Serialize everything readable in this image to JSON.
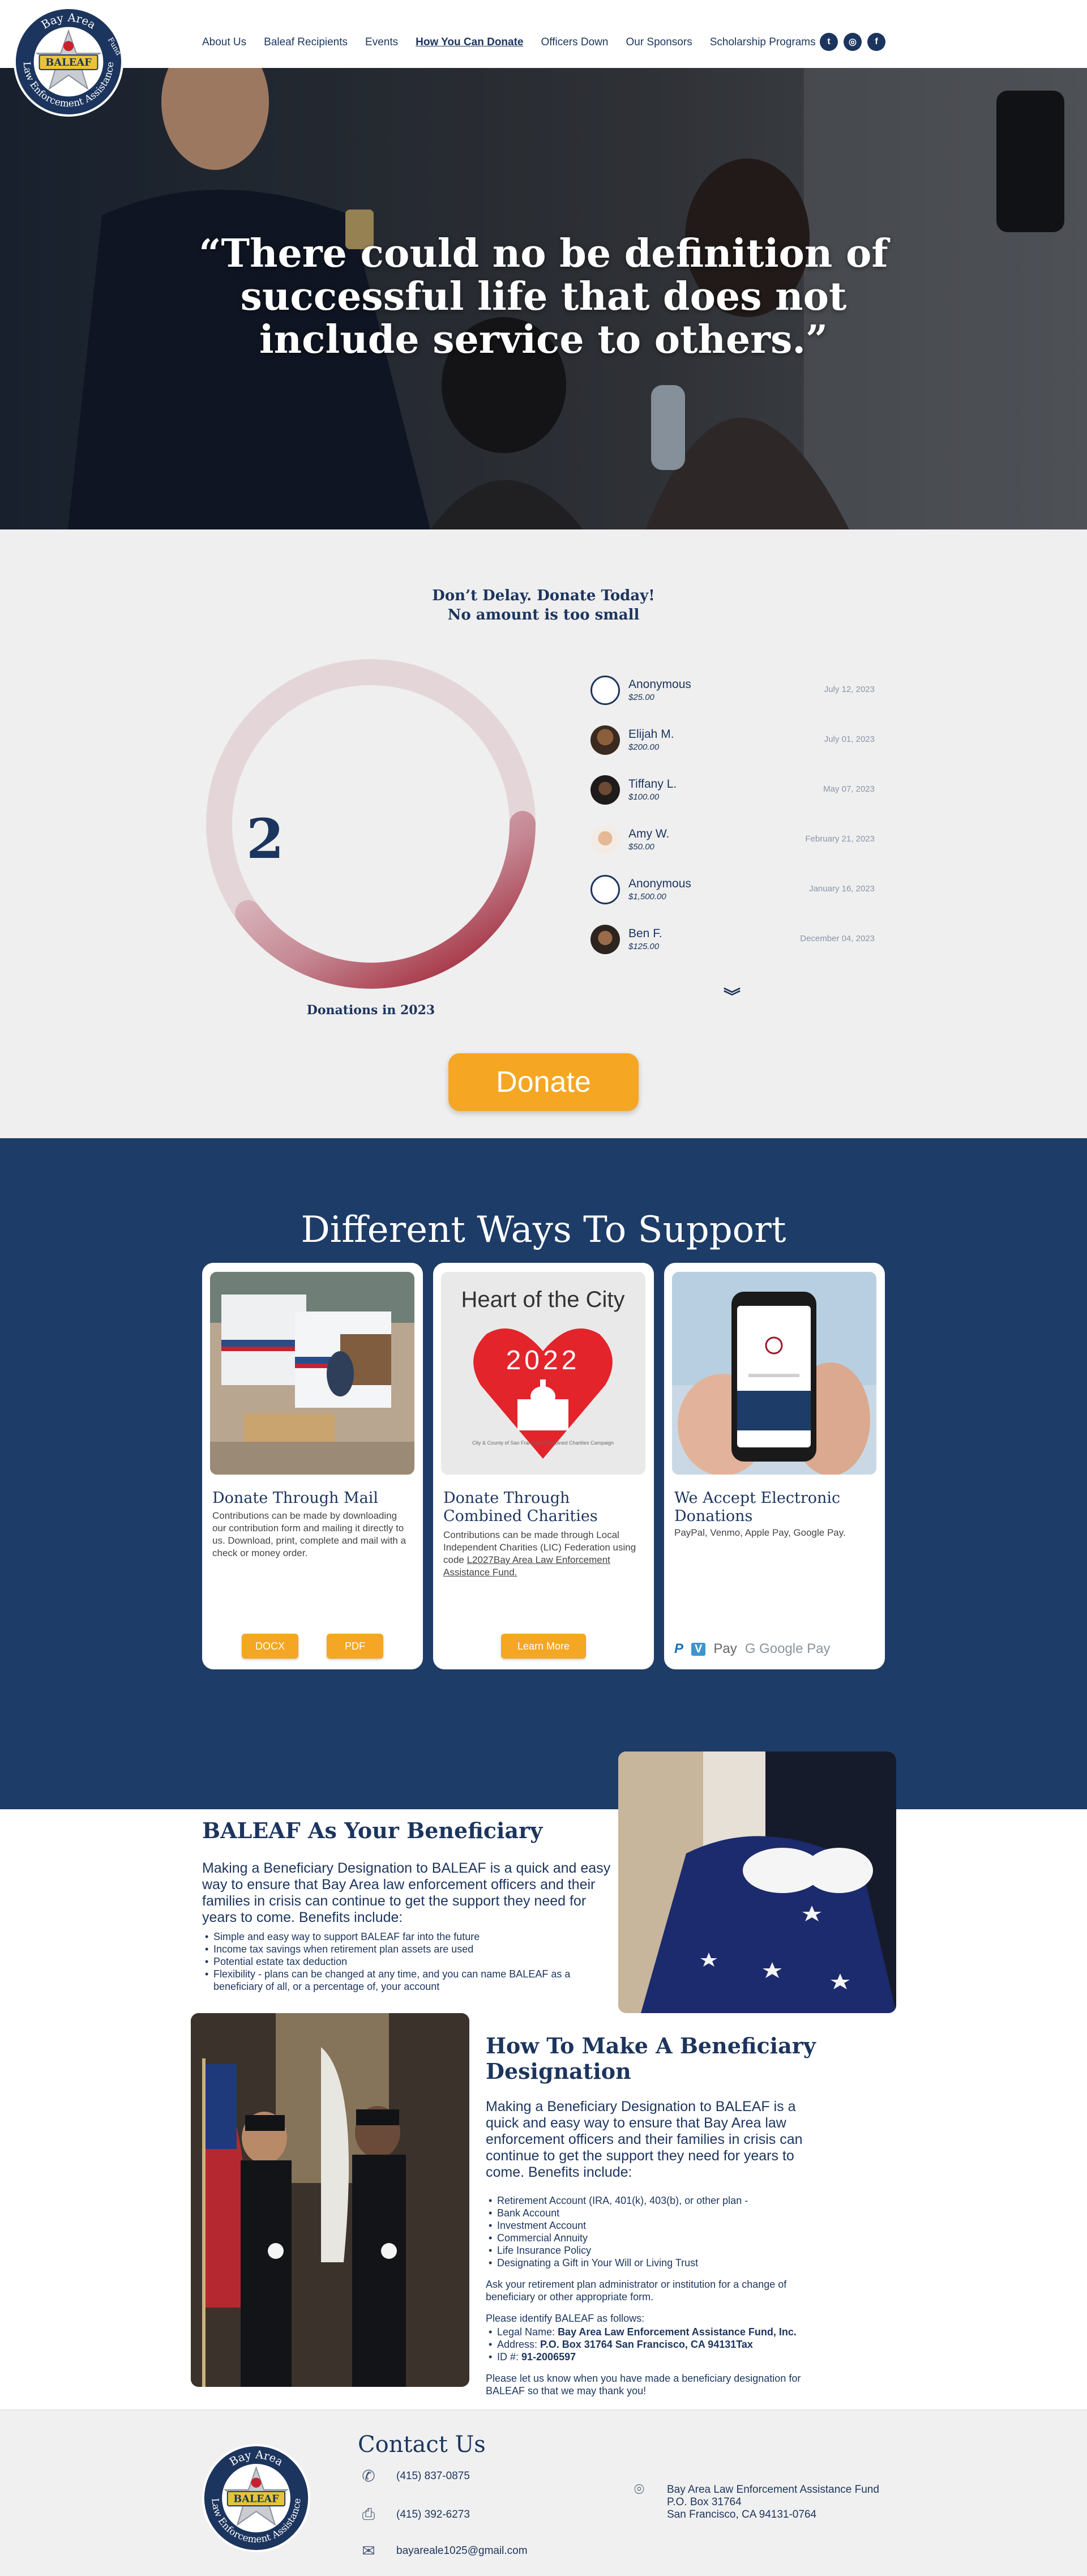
{
  "nav": {
    "links": [
      "About Us",
      "Baleaf Recipients",
      "Events",
      "How You Can Donate",
      "Officers Down",
      "Our Sponsors",
      "Scholarship Programs"
    ],
    "active_index": 3,
    "social": [
      {
        "icon": "twitter-icon",
        "glyph": "t"
      },
      {
        "icon": "instagram-icon",
        "glyph": "◎"
      },
      {
        "icon": "facebook-icon",
        "glyph": "f"
      }
    ]
  },
  "logo": {
    "top_text": "Bay Area",
    "banner": "BALEAF",
    "bottom_text": "Law Enforcement Assistance",
    "side_text": "Fund"
  },
  "hero": {
    "quote_line1": "“There could no be definition of",
    "quote_line2": "successful life that does not",
    "quote_line3": "include service to others.”"
  },
  "donations": {
    "headline1": "Don’t Delay. Donate Today!",
    "headline2": "No amount is too small",
    "count": "2",
    "count_label": "Donations in 2023",
    "ring_progress": 0.5,
    "donors": [
      {
        "name": "Anonymous",
        "amount": "$25.00",
        "date": "July 12, 2023",
        "avatar": "anon"
      },
      {
        "name": "Elijah M.",
        "amount": "$200.00",
        "date": "July 01, 2023",
        "avatar": "photo1"
      },
      {
        "name": "Tiffany L.",
        "amount": "$100.00",
        "date": "May 07, 2023",
        "avatar": "photo2"
      },
      {
        "name": "Amy W.",
        "amount": "$50.00",
        "date": "February 21, 2023",
        "avatar": "photo3"
      },
      {
        "name": "Anonymous",
        "amount": "$1,500.00",
        "date": "January 16, 2023",
        "avatar": "anon"
      },
      {
        "name": "Ben F.",
        "amount": "$125.00",
        "date": "December 04, 2023",
        "avatar": "photo4"
      }
    ],
    "button_label": "Donate",
    "colors": {
      "ring_start": "#e3c9cd",
      "ring_end": "#9b1628",
      "button": "#f5a623"
    }
  },
  "support": {
    "title": "Different Ways To Support",
    "cards": [
      {
        "title": "Donate Through Mail",
        "body": "Contributions can be made by downloading our contribution form and mailing it directly to us. Download, print, complete and mail with a check or money order.",
        "buttons": [
          "DOCX",
          "PDF"
        ]
      },
      {
        "title": "Donate Through Combined Charities",
        "image_title": "Heart of the City",
        "image_year": "2022",
        "image_ring": "City & County of San Francisco Combined Charities Campaign",
        "body_pre": "Contributions can be made through Local Independent Charities (LIC) Federation using code ",
        "body_link": "L2027Bay Area Law Enforcement Assistance Fund.",
        "buttons": [
          "Learn More"
        ]
      },
      {
        "title": "We Accept Electronic Donations",
        "body": "PayPal, Venmo, Apple Pay, Google Pay.",
        "payment_logos": [
          "P",
          "V",
          " Pay",
          "G Google Pay"
        ]
      }
    ]
  },
  "beneficiary": {
    "title": "BALEAF  As Your Beneficiary",
    "lead": "Making a Beneficiary Designation to BALEAF is a quick and easy way to ensure that Bay Area law enforcement officers and their families in crisis can continue to get the support they need for years to come. Benefits include:",
    "benefits": [
      "Simple and easy way to support BALEAF far into the future",
      "Income tax savings when retirement plan assets are used",
      "Potential estate tax deduction",
      "Flexibility - plans can be changed at any time, and you can name BALEAF as a beneficiary of all, or a percentage of, your account"
    ]
  },
  "designation": {
    "title": "How To Make A Beneficiary Designation",
    "lead": "Making a Beneficiary Designation to BALEAF is a quick and easy way to ensure that Bay Area law enforcement officers and their families in crisis can continue to get the support they need for years to come. Benefits include:",
    "items": [
      "Retirement Account (IRA, 401(k), 403(b), or other plan -",
      "Bank Account",
      "Investment Account",
      "Commercial Annuity",
      "Life Insurance Policy",
      "Designating a Gift in Your Will or Living Trust"
    ],
    "ask": "Ask your retirement plan administrator or institution for a change of beneficiary or other appropriate form.",
    "identify": "Please identify BALEAF as follows:",
    "legal_label": "Legal Name: ",
    "legal_value": "Bay Area Law Enforcement Assistance Fund, Inc.",
    "address_label": "Address: ",
    "address_value": "P.O. Box 31764 San Francisco, CA 94131Tax",
    "id_label": "ID #: ",
    "id_value": "91-2006597",
    "closing": "Please let us know when you have made a beneficiary designation for BALEAF so that we may thank you!"
  },
  "footer": {
    "title": "Contact Us",
    "phone": "(415) 837-0875",
    "fax": "(415) 392-6273",
    "email": "bayareale1025@gmail.com",
    "address_lines": [
      "Bay Area Law Enforcement Assistance Fund",
      "P.O. Box 31764",
      "San Francisco, CA 94131-0764"
    ]
  }
}
